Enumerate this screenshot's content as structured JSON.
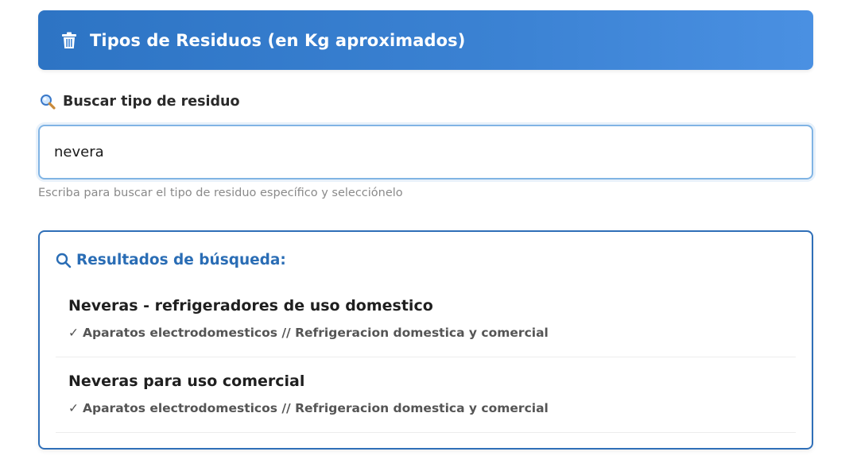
{
  "header": {
    "title": "Tipos de Residuos (en Kg aproximados)",
    "icon": "trash-icon"
  },
  "search": {
    "label": "Buscar tipo de residuo",
    "label_icon": "magnifier-icon",
    "value": "nevera",
    "helper": "Escriba para buscar el tipo de residuo específico y selecciónelo"
  },
  "results": {
    "title": "Resultados de búsqueda:",
    "title_icon": "search-icon",
    "items": [
      {
        "name": "Neveras - refrigeradores de uso domestico",
        "check": "✓",
        "category": "Aparatos electrodomesticos // Refrigeracion domestica y comercial"
      },
      {
        "name": "Neveras para uso comercial",
        "check": "✓",
        "category": "Aparatos electrodomesticos // Refrigeracion domestica y comercial"
      }
    ]
  },
  "colors": {
    "header_gradient_start": "#2d74c4",
    "header_gradient_end": "#4a90e2",
    "accent_blue": "#2a6db5",
    "input_border": "#80b4e4"
  }
}
